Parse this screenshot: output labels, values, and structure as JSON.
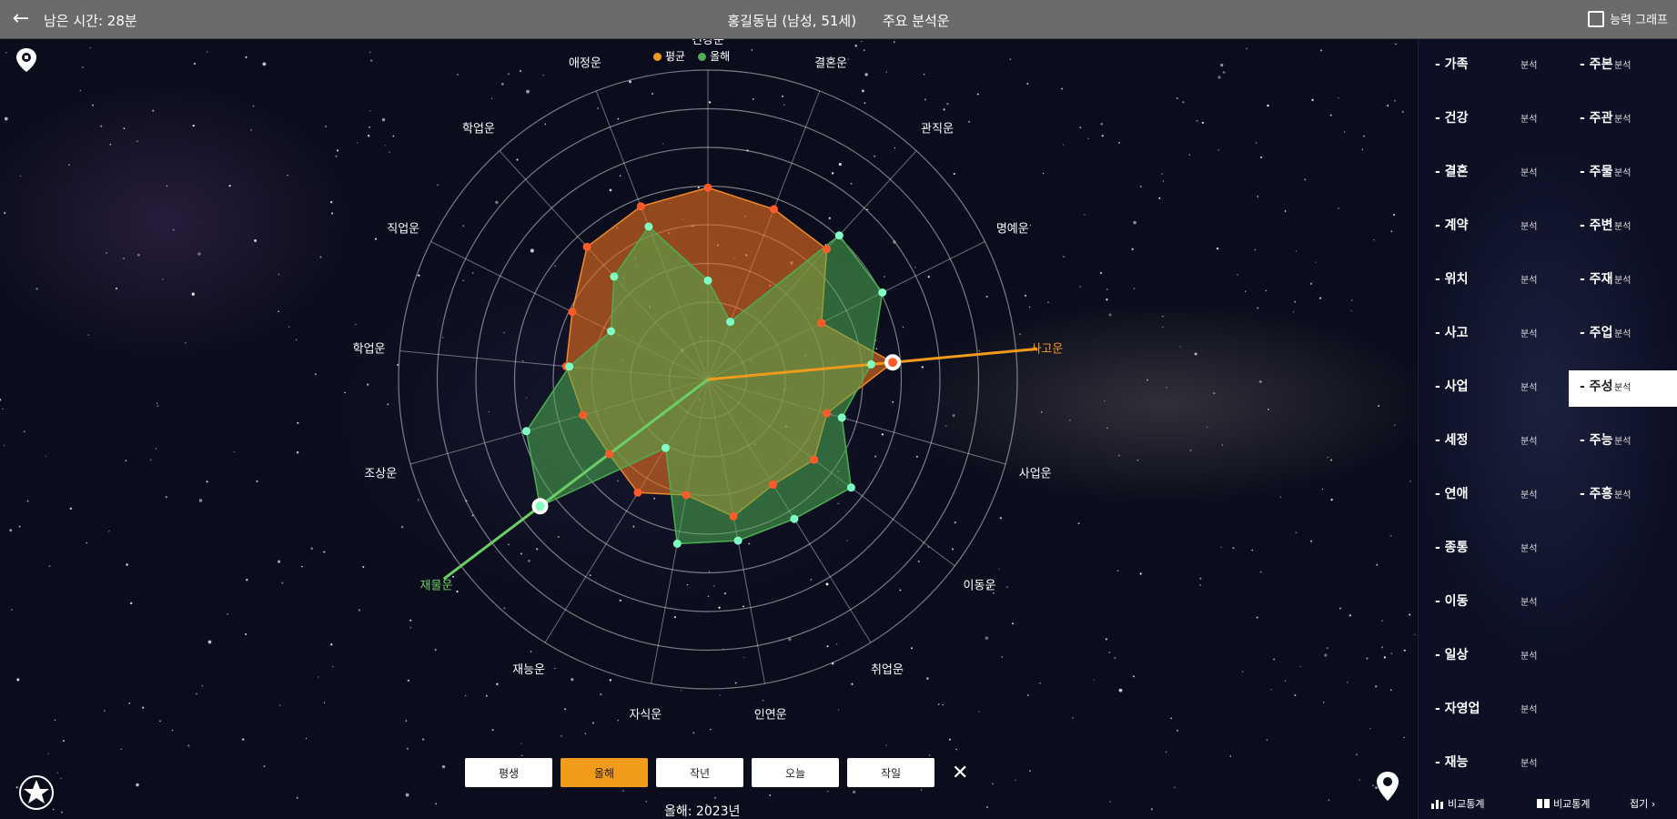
{
  "header": {
    "back_icon": "arrow-left-icon",
    "timer": "남은 시간: 28분",
    "user": "홍길동님 (남성, 51세)",
    "title": "주요 분석운",
    "compare_label": "능력 그래프"
  },
  "legend": [
    {
      "name": "평균",
      "color": "#f29b1b"
    },
    {
      "name": "올해",
      "color": "#4caf50"
    }
  ],
  "chart_data": {
    "type": "radar",
    "categories": [
      "건강운",
      "결혼운",
      "관직운",
      "명예운",
      "사고운",
      "사업운",
      "이동운",
      "취업운",
      "인연운",
      "자식운",
      "재능운",
      "재물운",
      "조상운",
      "학업운",
      "직업운",
      "학업운",
      "애정운"
    ],
    "rmax": 10,
    "rings": 8,
    "series": [
      {
        "name": "평균",
        "color": "#e8602c",
        "values": [
          6.2,
          5.9,
          5.7,
          4.1,
          6.0,
          4.0,
          4.3,
          4.0,
          4.5,
          3.8,
          4.3,
          4.0,
          4.2,
          4.6,
          4.9,
          5.8,
          6.0
        ]
      },
      {
        "name": "올해",
        "color": "#4caf50",
        "values": [
          3.2,
          2.0,
          6.3,
          6.3,
          5.3,
          4.5,
          5.8,
          5.3,
          5.3,
          5.4,
          2.6,
          6.8,
          6.1,
          4.5,
          3.5,
          4.5,
          5.3
        ]
      }
    ],
    "highlight": [
      {
        "series": "평균",
        "category": "사고운"
      },
      {
        "series": "올해",
        "category": "재물운"
      }
    ]
  },
  "buttons": [
    {
      "label": "평생",
      "active": false
    },
    {
      "label": "올해",
      "active": true
    },
    {
      "label": "작년",
      "active": false
    },
    {
      "label": "오늘",
      "active": false
    },
    {
      "label": "작일",
      "active": false
    }
  ],
  "footer_year": "올해: 2023년",
  "left_icons": [
    "map-pin-icon",
    "star-pentagon-icon"
  ],
  "right_icon": "location-pin-icon",
  "sidebar": {
    "rows": [
      {
        "left": "- 가족",
        "left_tag": "분석",
        "right": "- 주본",
        "right_tag": "분석",
        "selected": false
      },
      {
        "left": "- 건강",
        "left_tag": "분석",
        "right": "- 주관",
        "right_tag": "분석",
        "selected": false
      },
      {
        "left": "- 결혼",
        "left_tag": "분석",
        "right": "- 주물",
        "right_tag": "분석",
        "selected": false
      },
      {
        "left": "- 계약",
        "left_tag": "분석",
        "right": "- 주변",
        "right_tag": "분석",
        "selected": false
      },
      {
        "left": "- 위치",
        "left_tag": "분석",
        "right": "- 주재",
        "right_tag": "분석",
        "selected": false
      },
      {
        "left": "- 사고",
        "left_tag": "분석",
        "right": "- 주업",
        "right_tag": "분석",
        "selected": false
      },
      {
        "left": "- 사업",
        "left_tag": "분석",
        "right": "- 주성",
        "right_tag": "분석",
        "selected": true
      },
      {
        "left": "- 세정",
        "left_tag": "분석",
        "right": "- 주능",
        "right_tag": "분석",
        "selected": false
      },
      {
        "left": "- 연애",
        "left_tag": "분석",
        "right": "- 주흥",
        "right_tag": "분석",
        "selected": false
      },
      {
        "left": "- 종통",
        "left_tag": "분석",
        "right": "",
        "right_tag": "",
        "selected": false
      },
      {
        "left": "- 이동",
        "left_tag": "분석",
        "right": "",
        "right_tag": "",
        "selected": false
      },
      {
        "left": "- 일상",
        "left_tag": "분석",
        "right": "",
        "right_tag": "",
        "selected": false
      },
      {
        "left": "- 자영업",
        "left_tag": "분석",
        "right": "",
        "right_tag": "",
        "selected": false
      },
      {
        "left": "- 재능",
        "left_tag": "분석",
        "right": "",
        "right_tag": "",
        "selected": false
      }
    ],
    "bottom": {
      "chart_label": "비교통계",
      "book_label": "비교통계",
      "more_label": "접기 ›"
    }
  }
}
